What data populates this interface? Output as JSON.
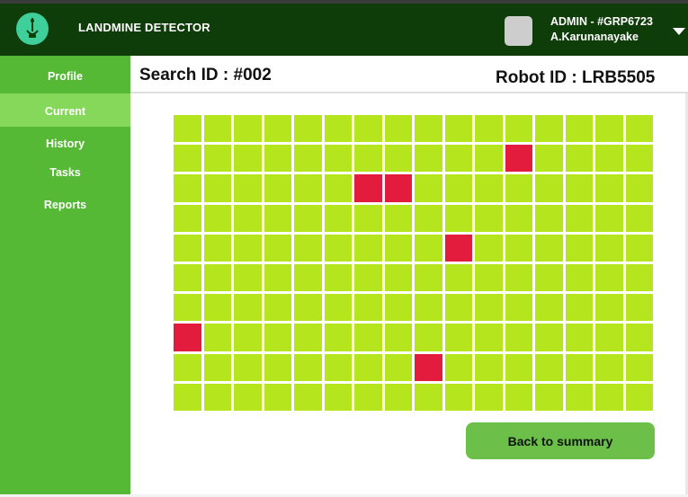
{
  "header": {
    "app_title": "LANDMINE DETECTOR",
    "logo_icon": "landmine-detector-logo",
    "user": {
      "role_line": "ADMIN - #GRP6723",
      "name": "A.Karunanayake"
    },
    "colors": {
      "background": "#0f3d0a",
      "logo": "#3ecf9a"
    }
  },
  "sidebar": {
    "background": "#56b936",
    "active_background": "#86d85a",
    "items": [
      {
        "label": "Profile",
        "active": false
      },
      {
        "label": "Current",
        "active": true
      },
      {
        "label": "History",
        "active": false
      },
      {
        "label": "Tasks",
        "active": false
      },
      {
        "label": "Reports",
        "active": false
      }
    ]
  },
  "main": {
    "search_id": "Search ID : #002",
    "robot_id": "Robot ID : LRB5505",
    "grid": {
      "rows": 10,
      "cols": 16,
      "safe_color": "#b5e61d",
      "mine_color": "#e31c3d",
      "mines": [
        [
          1,
          11
        ],
        [
          2,
          6
        ],
        [
          2,
          7
        ],
        [
          4,
          9
        ],
        [
          7,
          0
        ],
        [
          8,
          8
        ]
      ]
    },
    "back_button": "Back to summary"
  }
}
